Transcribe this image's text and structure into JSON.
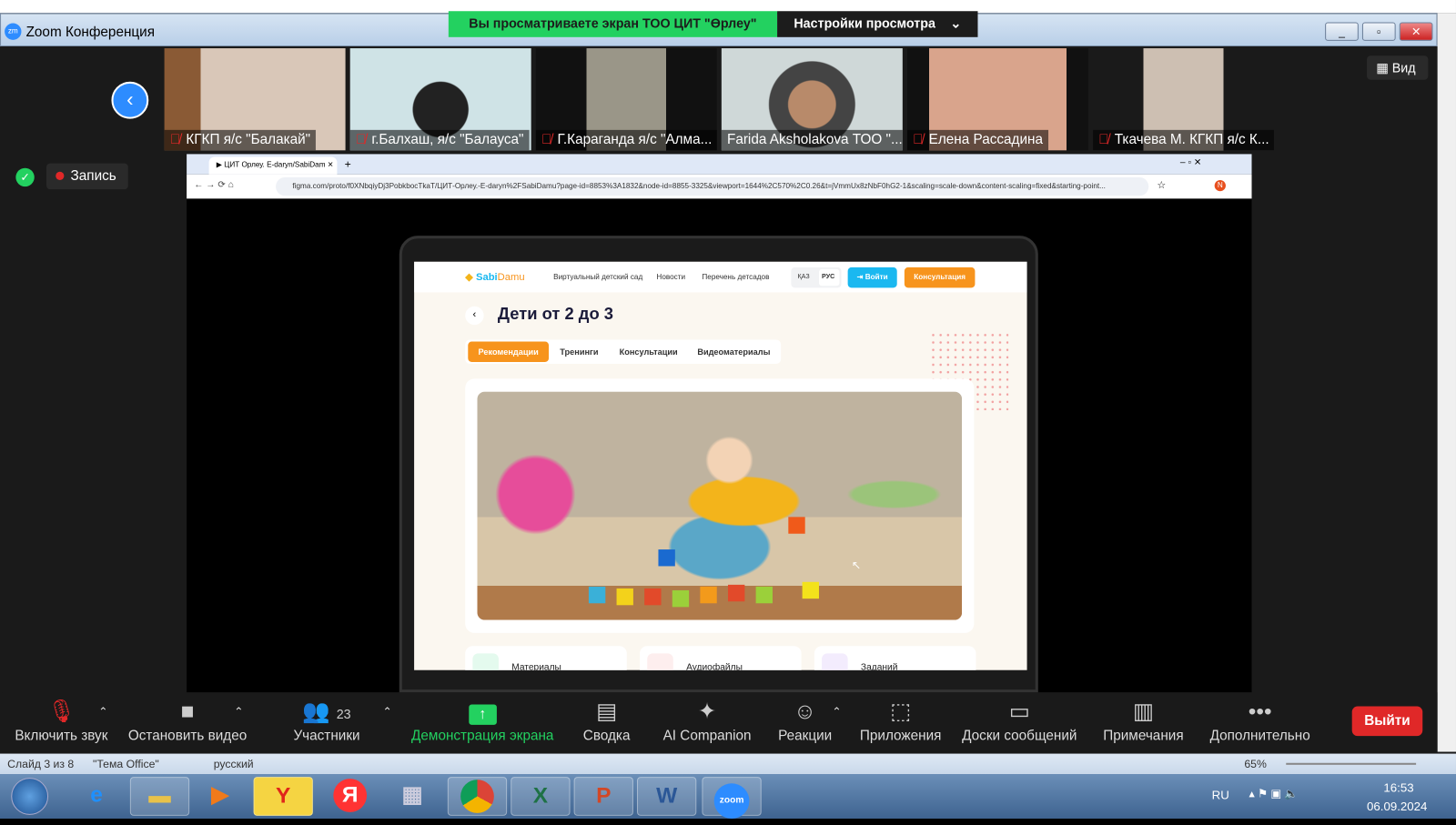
{
  "window": {
    "title": "Zoom Конференция",
    "logo": "zm"
  },
  "share_banner": {
    "text": "Вы просматриваете экран ТОО  ЦИТ \"Өрлеу\"",
    "settings": "Настройки просмотра"
  },
  "participants": [
    {
      "name": "КГКП я/с \"Балакай\"",
      "muted": true
    },
    {
      "name": "г.Балхаш, я/с \"Балауса\"",
      "muted": true
    },
    {
      "name": "Г.Караганда я/с \"Алма...",
      "muted": true
    },
    {
      "name": "Farida Aksholakova ТОО \"...",
      "muted": false
    },
    {
      "name": "Елена Рассадина",
      "muted": true
    },
    {
      "name": "Ткачева М. КГКП я/с К...",
      "muted": true
    }
  ],
  "view_button": "Вид",
  "recording": "Запись",
  "browser": {
    "tab_title": "ЦИТ Орлеу. E-daryn/SabiDam",
    "url": "figma.com/proto/f0XNbqiyDj3PobkbocTkaT/ЦИТ-Орлеу.-E-daryn%2FSabiDamu?page-id=8853%3A1832&node-id=8855-3325&viewport=1644%2C570%2C0.26&t=jVmmUx8zNbF0hG2-1&scaling=scale-down&content-scaling=fixed&starting-point...",
    "profile": "N"
  },
  "site": {
    "logo_a": "Sabi",
    "logo_b": "Damu",
    "nav": [
      "Виртуальный детский сад",
      "Новости",
      "Перечень детсадов"
    ],
    "lang": [
      "ҚАЗ",
      "РУС"
    ],
    "login": "Войти",
    "consult": "Консультация",
    "page_title": "Дети от 2 до 3",
    "tabs": [
      "Рекомендации",
      "Тренинги",
      "Консультации",
      "Видеоматериалы"
    ],
    "cards": [
      "Материалы",
      "Аудиофайлы",
      "Заданий"
    ],
    "accent": "#f7941d",
    "blue": "#1ab8f0"
  },
  "toolbar": {
    "items": [
      "Включить звук",
      "Остановить видео",
      "Участники",
      "Демонстрация экрана",
      "Сводка",
      "AI Companion",
      "Реакции",
      "Приложения",
      "Доски сообщений",
      "Примечания",
      "Дополнительно"
    ],
    "participants_count": "23",
    "leave": "Выйти"
  },
  "ppt_status": {
    "slide": "Слайд 3 из 8",
    "theme": "\"Тема Office\"",
    "lang": "русский",
    "zoom": "65%"
  },
  "taskbar": {
    "lang": "RU",
    "time": "16:53",
    "date": "06.09.2024"
  }
}
